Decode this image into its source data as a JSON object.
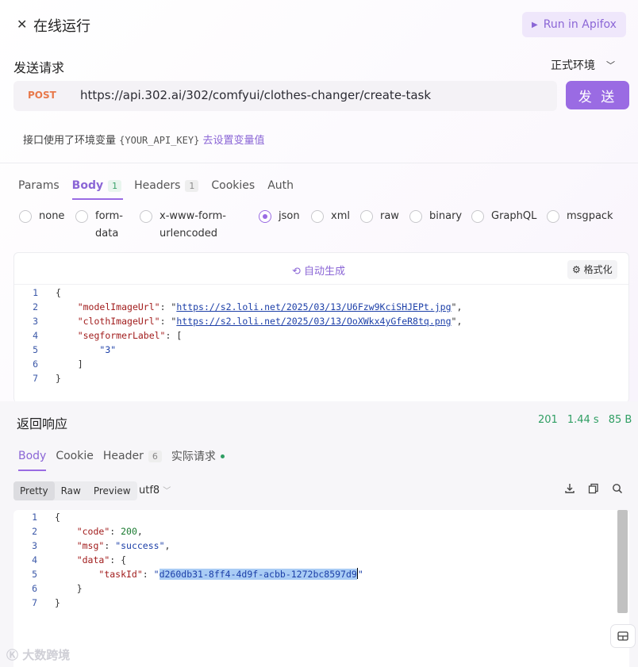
{
  "header": {
    "title": "在线运行",
    "run_label": "Run in Apifox"
  },
  "request": {
    "section_label": "发送请求",
    "environment": "正式环境",
    "method": "POST",
    "url": "https://api.302.ai/302/comfyui/clothes-changer/create-task",
    "send_label": "发 送",
    "env_note": {
      "prefix": "接口使用了环境变量",
      "variable": "{YOUR_API_KEY}",
      "link": "去设置变量值"
    },
    "tabs": [
      {
        "label": "Params"
      },
      {
        "label": "Body",
        "badge": "1"
      },
      {
        "label": "Headers",
        "badge": "1"
      },
      {
        "label": "Cookies"
      },
      {
        "label": "Auth"
      }
    ],
    "body_types": [
      {
        "label": "none"
      },
      {
        "label": "form-\ndata"
      },
      {
        "label": "x-www-form-\nurlencoded"
      },
      {
        "label": "json",
        "selected": true
      },
      {
        "label": "xml"
      },
      {
        "label": "raw"
      },
      {
        "label": "binary"
      },
      {
        "label": "GraphQL"
      },
      {
        "label": "msgpack"
      }
    ],
    "autogen_label": "自动生成",
    "format_label": "格式化",
    "code_lines": [
      "1",
      "2",
      "3",
      "4",
      "5",
      "6",
      "7"
    ],
    "json": {
      "model_key": "\"modelImageUrl\"",
      "model_val": "https://s2.loli.net/2025/03/13/U6Fzw9KciSHJEPt.jpg",
      "cloth_key": "\"clothImageUrl\"",
      "cloth_val": "https://s2.loli.net/2025/03/13/OoXWkx4yGfeR8tq.png",
      "seg_key": "\"segformerLabel\"",
      "seg_val": "\"3\""
    }
  },
  "response": {
    "title": "返回响应",
    "status": "201",
    "time": "1.44 s",
    "size": "85 B",
    "tabs": [
      {
        "label": "Body"
      },
      {
        "label": "Cookie"
      },
      {
        "label": "Header",
        "badge": "6"
      },
      {
        "label": "实际请求"
      }
    ],
    "views": [
      "Pretty",
      "Raw",
      "Preview"
    ],
    "encoding": "utf8",
    "code_lines": [
      "1",
      "2",
      "3",
      "4",
      "5",
      "6",
      "7"
    ],
    "json": {
      "code_key": "\"code\"",
      "code_val": "200",
      "msg_key": "\"msg\"",
      "msg_val": "\"success\"",
      "data_key": "\"data\"",
      "task_key": "\"taskId\"",
      "task_val": "d260db31-8ff4-4d9f-acbb-1272bc8597d9"
    }
  },
  "watermark": "大数跨境",
  "colors": {
    "accent": "#9a6be3",
    "success": "#2f9e63",
    "method_post": "#e8784a"
  }
}
